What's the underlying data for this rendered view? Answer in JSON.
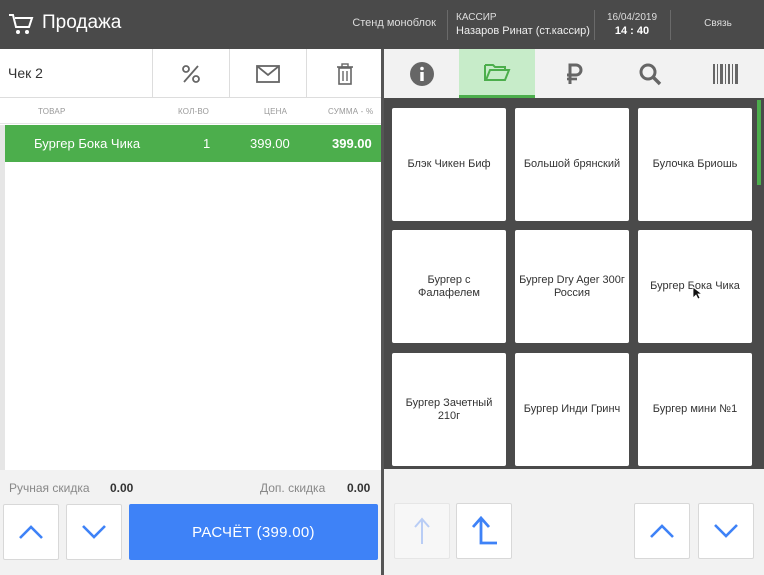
{
  "header": {
    "title": "Продажа",
    "stand": "Стенд моноблок",
    "cashier_label": "КАССИР",
    "cashier_name": "Назаров Ринат (ст.кассир)",
    "date": "16/04/2019",
    "time": "14 : 40",
    "link_label": "Связь"
  },
  "check": {
    "title": "Чек 2",
    "tools": [
      "percent-icon",
      "envelope-icon",
      "trash-icon"
    ]
  },
  "columns": {
    "item": "ТОВАР",
    "qty": "КОЛ-ВО",
    "price": "ЦЕНА",
    "sum": "СУММА - %"
  },
  "rows": [
    {
      "name": "Бургер Бока Чика",
      "qty": "1",
      "price": "399.00",
      "sum": "399.00"
    }
  ],
  "discounts": {
    "manual_label": "Ручная скидка",
    "manual_value": "0.00",
    "extra_label": "Доп. скидка",
    "extra_value": "0.00"
  },
  "pay_button": "РАСЧЁТ (399.00)",
  "tabs": [
    "info-icon",
    "folder-open-icon",
    "ruble-icon",
    "search-icon",
    "barcode-icon"
  ],
  "active_tab": "folder-open-icon",
  "products": [
    "Блэк Чикен Биф",
    "Большой брянский",
    "Булочка Бриошь",
    "Бургер с Фалафелем",
    "Бургер Dry Ager 300г Россия",
    "Бургер Бока Чика",
    "Бургер Зачетный 210г",
    "Бургер Инди Гринч",
    "Бургер мини №1"
  ],
  "colors": {
    "header_bg": "#4a4a4a",
    "accent_green": "#4cae4c",
    "pay_blue": "#3e82f7",
    "arrow_blue": "#3e82f7"
  }
}
